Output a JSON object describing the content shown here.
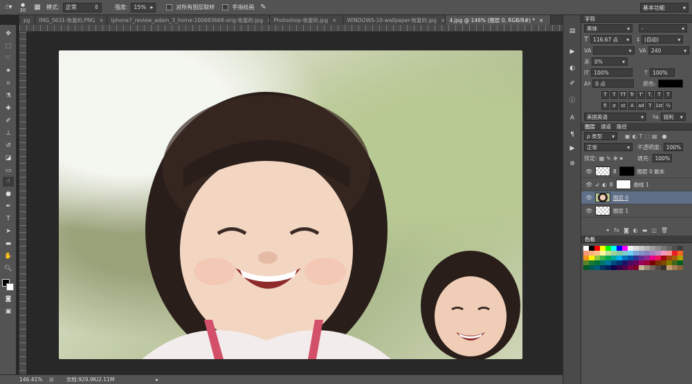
{
  "options_bar": {
    "brush_size": "30",
    "mode_label": "模式:",
    "mode_value": "正常",
    "strength_label": "强度:",
    "strength_value": "15%",
    "sample_all_label": "对所有图层取样",
    "finger_paint_label": "手指绘画",
    "workspace": "基本功能"
  },
  "tabs": [
    {
      "label": "pg",
      "active": false
    },
    {
      "label": "IMG_5631-恢复的.PNG",
      "active": false
    },
    {
      "label": "iphone7_review_adam_3_home-100683668-orig-恢复的.jpg",
      "active": false
    },
    {
      "label": "Photoshop-恢复的.jpg",
      "active": false
    },
    {
      "label": "WINDOWS-10-wallpaper-恢复的.jpg",
      "active": false
    },
    {
      "label": "4.jpg @ 146% (图层 0, RGB/8#) *",
      "active": true
    }
  ],
  "status": {
    "zoom": "146.41%",
    "doc": "文档:929.9K/2.11M"
  },
  "character_panel": {
    "title": "字符",
    "font_family": "黑体",
    "font_style": "-",
    "font_size": "116.67 点",
    "leading": "(自动)",
    "kerning": "",
    "tracking": "240",
    "scale_percent": "0%",
    "vertical_scale": "100%",
    "horizontal_scale": "100%",
    "baseline_shift": "0 点",
    "color_label": "颜色:",
    "style_buttons": [
      "T",
      "T",
      "TT",
      "Tr",
      "T'",
      "T,",
      "T",
      "T"
    ],
    "opentype_buttons": [
      "fi",
      "σ",
      "st",
      "A",
      "ad",
      "T",
      "1st",
      "½"
    ],
    "language": "美国英语",
    "antialias": "锐利"
  },
  "layers_panel": {
    "tabs": [
      "图层",
      "通道",
      "路径"
    ],
    "filter_kind": "ρ 类型",
    "blend_mode": "正常",
    "opacity_label": "不透明度:",
    "opacity_value": "100%",
    "lock_label": "锁定:",
    "fill_label": "填充:",
    "fill_value": "100%",
    "layers": [
      {
        "name": "图层 0 副本",
        "selected": false,
        "thumb": "checker",
        "mask": true
      },
      {
        "name": "曲线 1",
        "selected": false,
        "thumb": "adjust",
        "mask": true
      },
      {
        "name": "图层 0",
        "selected": true,
        "thumb": "photo",
        "mask": false
      },
      {
        "name": "图层 1",
        "selected": false,
        "thumb": "checker",
        "mask": false
      }
    ]
  },
  "swatches_panel": {
    "title": "色板",
    "colors": [
      "#ffffff",
      "#000000",
      "#ff0000",
      "#ffff00",
      "#00ff00",
      "#00ffff",
      "#0000ff",
      "#ff00ff",
      "#f0f0f0",
      "#dcdcdc",
      "#c8c8c8",
      "#b4b4b4",
      "#a0a0a0",
      "#8c8c8c",
      "#787878",
      "#646464",
      "#505050",
      "#3c3c3c",
      "#f7977a",
      "#f9ad81",
      "#fdc68a",
      "#fff79a",
      "#c4df9b",
      "#a2d39c",
      "#82ca9d",
      "#7bcdc8",
      "#6ecff6",
      "#7ea7d8",
      "#8493ca",
      "#8882be",
      "#a187be",
      "#bc8dbf",
      "#f49ac2",
      "#f6989d",
      "#ed1c24",
      "#f26522",
      "#f7941d",
      "#fff200",
      "#8dc63f",
      "#39b54a",
      "#00a651",
      "#00a99d",
      "#00aeef",
      "#0072bc",
      "#0054a6",
      "#2e3192",
      "#662d91",
      "#92278f",
      "#ec008c",
      "#ed145b",
      "#9e0b0f",
      "#a0410d",
      "#a36209",
      "#aba000",
      "#598527",
      "#197b30",
      "#007236",
      "#00746b",
      "#0076a3",
      "#004a80",
      "#003471",
      "#1b1464",
      "#440e62",
      "#630460",
      "#9e005d",
      "#9e0039",
      "#790000",
      "#7b2e00",
      "#7d4900",
      "#827b00",
      "#406618",
      "#005e20",
      "#005826",
      "#005952",
      "#005b7f",
      "#003663",
      "#002157",
      "#0d004c",
      "#32004b",
      "#4b0049",
      "#7b0046",
      "#7a0026",
      "#c7b299",
      "#998675",
      "#736357",
      "#534741",
      "#37302d",
      "#c69c6d",
      "#a67c52",
      "#8c6239"
    ]
  }
}
